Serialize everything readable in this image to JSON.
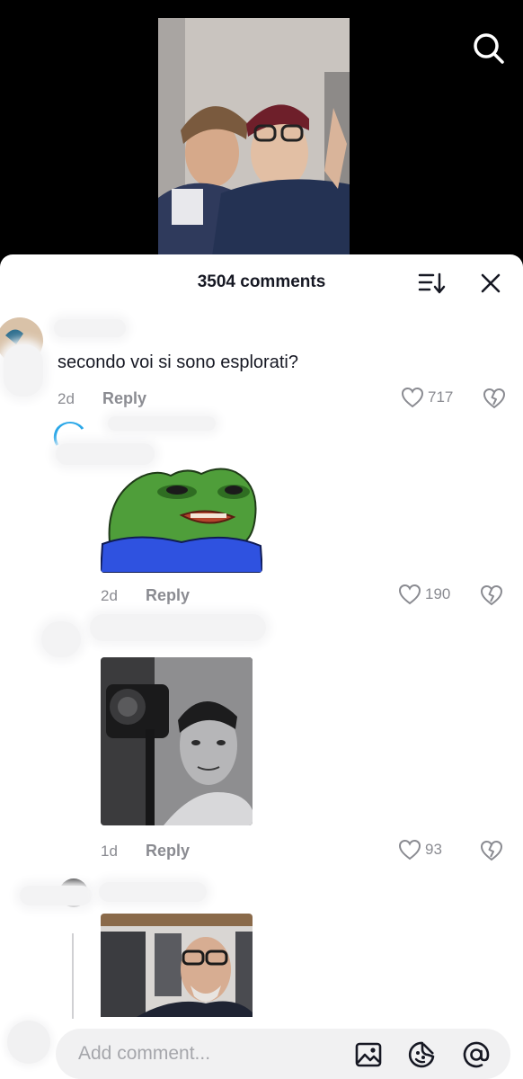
{
  "video": {
    "search_icon": "search-icon"
  },
  "comments_sheet": {
    "title": "3504 comments",
    "sort_icon": "sort-icon",
    "close_icon": "close-icon"
  },
  "comments": [
    {
      "text": "secondo voi si sono esplorati?",
      "time": "2d",
      "reply_label": "Reply",
      "likes": "717"
    },
    {
      "media": "pepe-frog-sticker",
      "time": "2d",
      "reply_label": "Reply",
      "likes": "190"
    },
    {
      "media": "photo-man-camera",
      "time": "1d",
      "reply_label": "Reply",
      "likes": "93"
    },
    {
      "media": "photo-bald-man-glasses"
    }
  ],
  "input": {
    "placeholder": "Add comment...",
    "image_icon": "image-icon",
    "emoji_icon": "emoji-icon",
    "mention_icon": "at-icon"
  },
  "colors": {
    "text_primary": "#161823",
    "text_secondary": "#8a8b91",
    "sheet_bg": "#ffffff",
    "input_bg": "#f1f1f2"
  }
}
